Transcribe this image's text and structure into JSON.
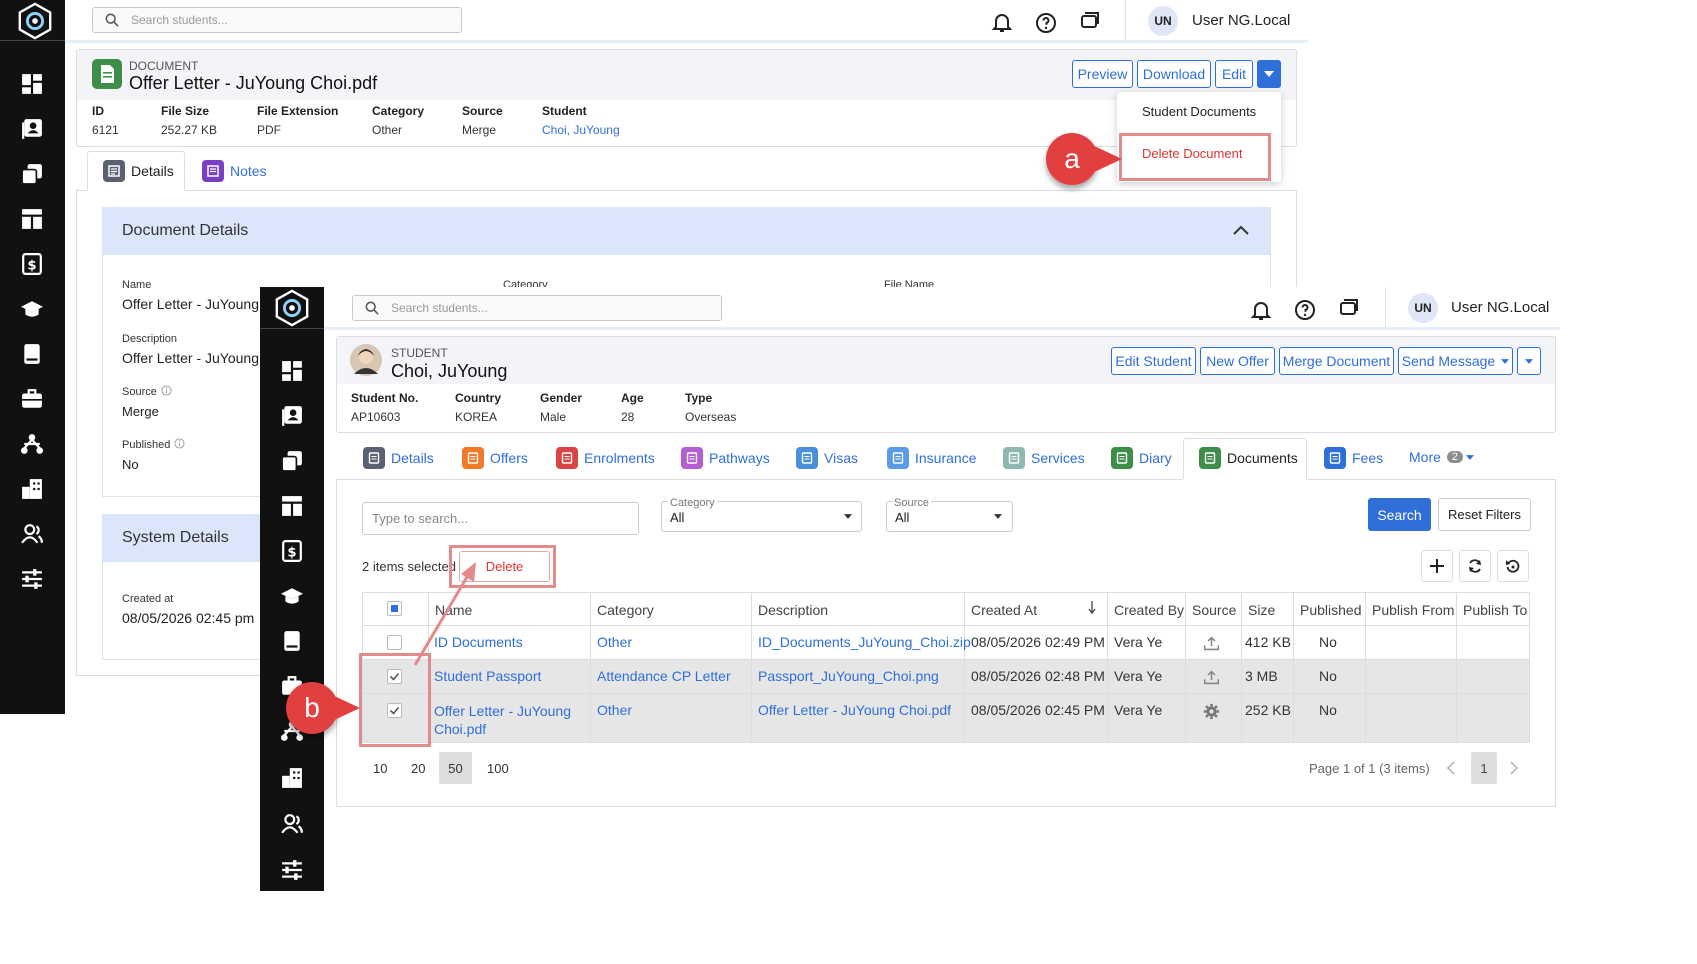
{
  "back": {
    "search_placeholder": "Search students...",
    "user_initials": "UN",
    "user_name": "User NG.Local",
    "doc_type": "DOCUMENT",
    "doc_title": "Offer Letter - JuYoung Choi.pdf",
    "buttons": {
      "preview": "Preview",
      "download": "Download",
      "edit": "Edit"
    },
    "menu": {
      "student_documents": "Student Documents",
      "delete_document": "Delete Document"
    },
    "fields": [
      {
        "label": "ID",
        "value": "6121"
      },
      {
        "label": "File Size",
        "value": "252.27 KB"
      },
      {
        "label": "File Extension",
        "value": "PDF"
      },
      {
        "label": "Category",
        "value": "Other"
      },
      {
        "label": "Source",
        "value": "Merge"
      },
      {
        "label": "Student",
        "value": "Choi, JuYoung"
      }
    ],
    "tabs": {
      "details": "Details",
      "notes": "Notes"
    },
    "document_details": {
      "title": "Document Details",
      "name_label": "Name",
      "name_value": "Offer Letter - JuYoung C",
      "category_label": "Category",
      "file_name_label": "File Name",
      "description_label": "Description",
      "description_value": "Offer Letter - JuYoung C",
      "source_label": "Source",
      "source_value": "Merge",
      "published_label": "Published",
      "published_value": "No"
    },
    "system_details": {
      "title": "System Details",
      "created_label": "Created at",
      "created_value": "08/05/2026 02:45 pm"
    }
  },
  "front": {
    "search_placeholder": "Search students...",
    "user_initials": "UN",
    "user_name": "User NG.Local",
    "type_label": "STUDENT",
    "student_name": "Choi, JuYoung",
    "buttons": {
      "edit_student": "Edit Student",
      "new_offer": "New Offer",
      "merge_document": "Merge Document",
      "send_message": "Send Message"
    },
    "fields": [
      {
        "label": "Student No.",
        "value": "AP10603"
      },
      {
        "label": "Country",
        "value": "KOREA"
      },
      {
        "label": "Gender",
        "value": "Male"
      },
      {
        "label": "Age",
        "value": "28"
      },
      {
        "label": "Type",
        "value": "Overseas"
      }
    ],
    "tabs": [
      {
        "label": "Details",
        "color": "#5a6170"
      },
      {
        "label": "Offers",
        "color": "#f07a2a"
      },
      {
        "label": "Enrolments",
        "color": "#d94545"
      },
      {
        "label": "Pathways",
        "color": "#b45fd1"
      },
      {
        "label": "Visas",
        "color": "#4a8fd9"
      },
      {
        "label": "Insurance",
        "color": "#5b9be6"
      },
      {
        "label": "Services",
        "color": "#8fb8b0"
      },
      {
        "label": "Diary",
        "color": "#3e8e4a"
      },
      {
        "label": "Documents",
        "color": "#3e8e4a"
      },
      {
        "label": "Fees",
        "color": "#2f6fd8"
      }
    ],
    "more_label": "More",
    "more_count": "2",
    "filters": {
      "search_placeholder": "Type to search...",
      "category_label": "Category",
      "category_value": "All",
      "source_label": "Source",
      "source_value": "All",
      "search_button": "Search",
      "reset_button": "Reset Filters"
    },
    "selection": {
      "count_text": "2 items selected",
      "delete_button": "Delete"
    },
    "table": {
      "columns": [
        "Name",
        "Category",
        "Description",
        "Created At",
        "Created By",
        "Source",
        "Size",
        "Published",
        "Publish From",
        "Publish To"
      ],
      "rows": [
        {
          "name": "ID Documents",
          "category": "Other",
          "description": "ID_Documents_JuYoung_Choi.zip",
          "created_at": "08/05/2026 02:49 PM",
          "created_by": "Vera Ye",
          "source_icon": "upload-icon",
          "size": "412 KB",
          "published": "No",
          "checked": false
        },
        {
          "name": "Student Passport",
          "category": "Attendance CP Letter",
          "description": "Passport_JuYoung_Choi.png",
          "created_at": "08/05/2026 02:48 PM",
          "created_by": "Vera Ye",
          "source_icon": "upload-icon",
          "size": "3 MB",
          "published": "No",
          "checked": true
        },
        {
          "name": "Offer Letter - JuYoung Choi.pdf",
          "category": "Other",
          "description": "Offer Letter - JuYoung Choi.pdf",
          "created_at": "08/05/2026 02:45 PM",
          "created_by": "Vera Ye",
          "source_icon": "gear-icon",
          "size": "252 KB",
          "published": "No",
          "checked": true
        }
      ]
    },
    "page_sizes": [
      "10",
      "20",
      "50",
      "100"
    ],
    "page_info": "Page 1 of 1 (3 items)",
    "current_page": "1"
  },
  "callouts": {
    "a": "a",
    "b": "b"
  },
  "colors": {
    "accent": "#2f6fd8",
    "sidebar": "#111111",
    "callout": "#e24040",
    "highlight_box": "#e38a8a",
    "selected_row": "#e6e6e6"
  }
}
